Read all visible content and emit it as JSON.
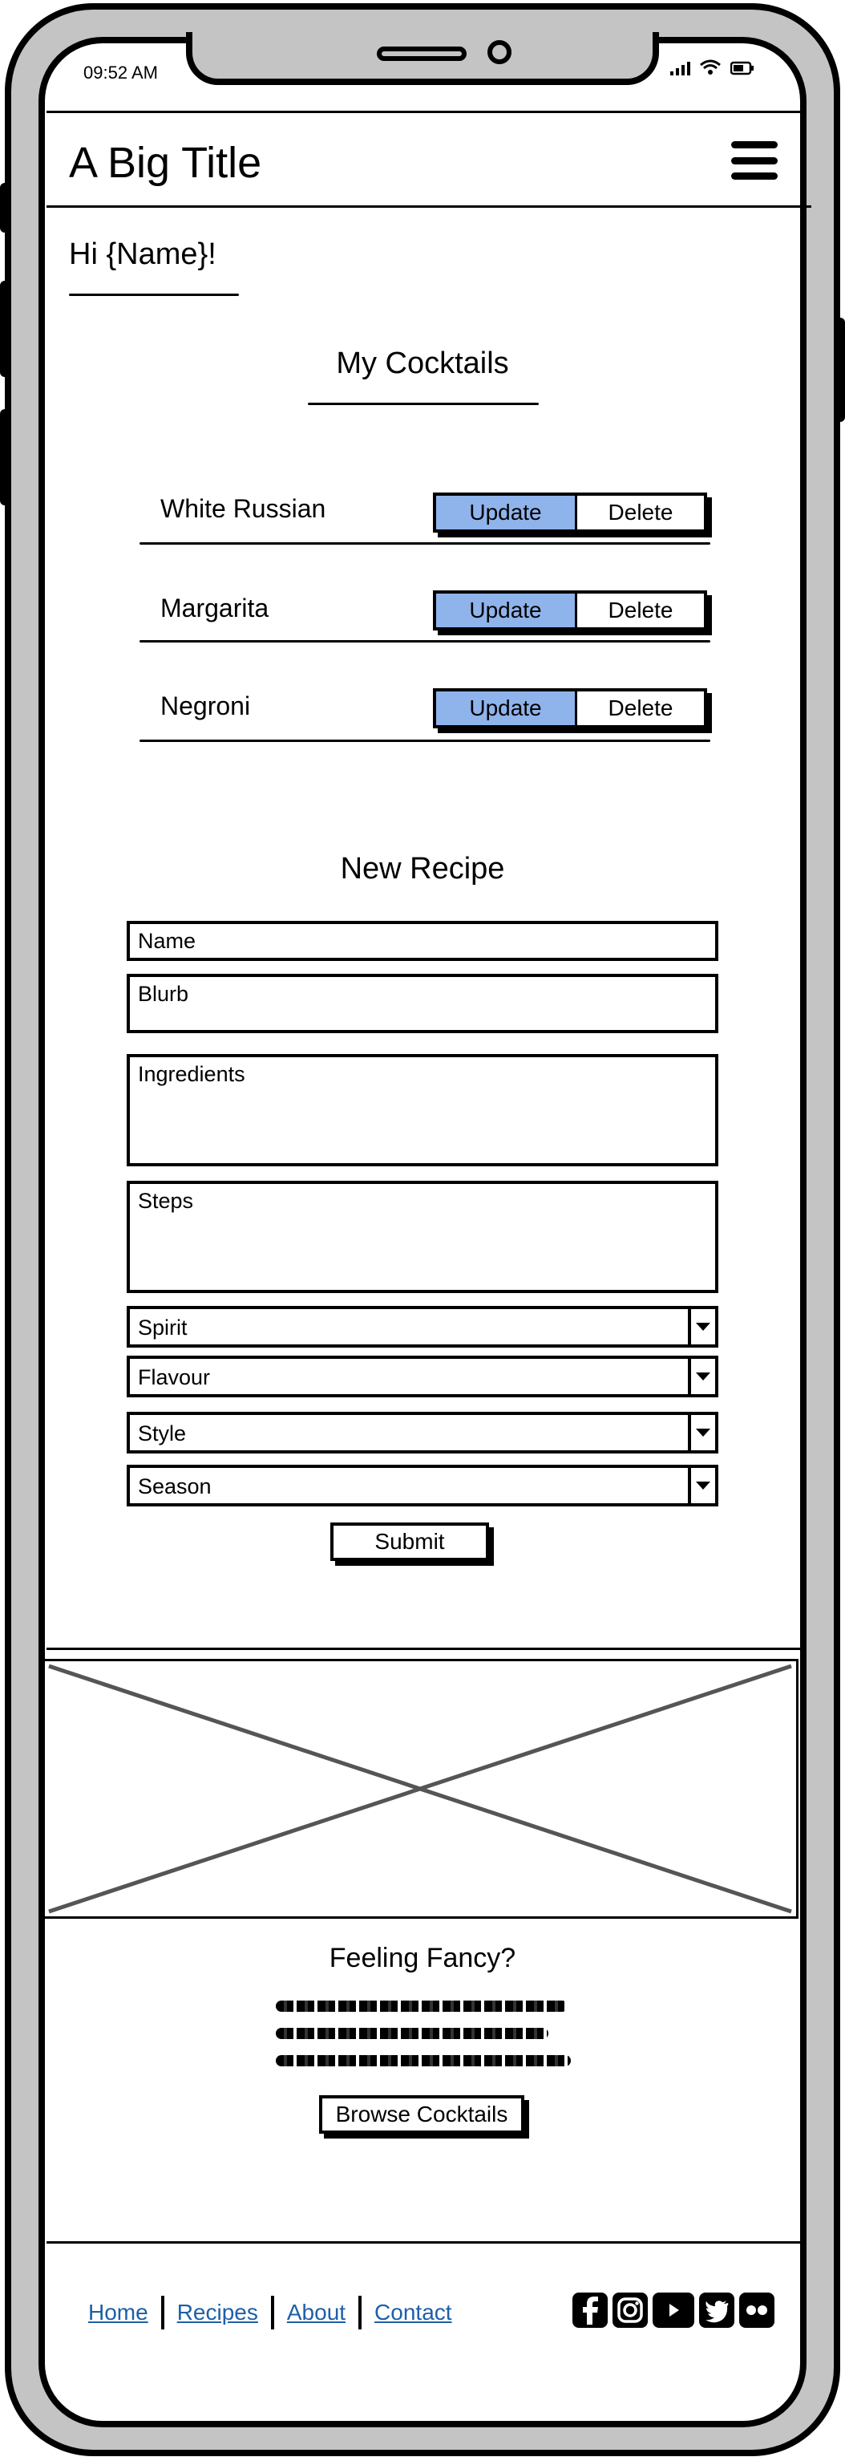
{
  "status_bar": {
    "time": "09:52 AM"
  },
  "header": {
    "title": "A Big Title"
  },
  "greeting": "Hi {Name}!",
  "my_cocktails": {
    "heading": "My Cocktails",
    "items": [
      {
        "name": "White Russian",
        "update_label": "Update",
        "delete_label": "Delete"
      },
      {
        "name": "Margarita",
        "update_label": "Update",
        "delete_label": "Delete"
      },
      {
        "name": "Negroni",
        "update_label": "Update",
        "delete_label": "Delete"
      }
    ]
  },
  "new_recipe": {
    "heading": "New Recipe",
    "name_placeholder": "Name",
    "blurb_placeholder": "Blurb",
    "ingredients_placeholder": "Ingredients",
    "steps_placeholder": "Steps",
    "selects": {
      "spirit": "Spirit",
      "flavour": "Flavour",
      "style": "Style",
      "season": "Season"
    },
    "submit_label": "Submit"
  },
  "fancy": {
    "heading": "Feeling Fancy?",
    "button_label": "Browse Cocktails"
  },
  "footer": {
    "links": {
      "home": "Home",
      "recipes": "Recipes",
      "about": "About",
      "contact": "Contact"
    },
    "socials": [
      "facebook-icon",
      "instagram-icon",
      "youtube-icon",
      "twitter-icon",
      "flickr-icon"
    ]
  }
}
